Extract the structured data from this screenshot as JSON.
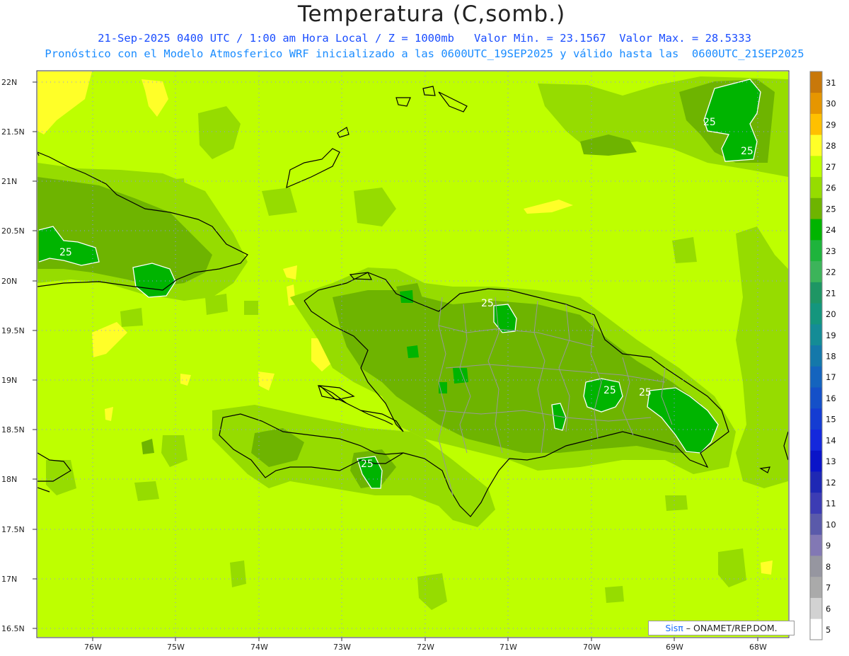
{
  "title": "Temperatura (C,somb.)",
  "subtitle_line1": "21-Sep-2025 0400 UTC / 1:00 am Hora Local / Z = 1000mb   Valor Min. = 23.1567  Valor Max. = 28.5333",
  "subtitle_line2": "Pronóstico con el Modelo Atmosferico WRF inicializado a las 0600UTC_19SEP2025 y válido hasta las  0600UTC_21SEP2025",
  "lat_labels": [
    "22N",
    "21.5N",
    "21N",
    "20.5N",
    "20N",
    "19.5N",
    "19N",
    "18.5N",
    "18N",
    "17.5N",
    "17N",
    "16.5N"
  ],
  "lon_labels": [
    "76W",
    "75W",
    "74W",
    "73W",
    "72W",
    "71W",
    "70W",
    "69W",
    "68W"
  ],
  "contour_labels": [
    "25",
    "25",
    "25",
    "25",
    "25",
    "25",
    "25"
  ],
  "colorbar": {
    "labels": [
      "31",
      "30",
      "29",
      "28",
      "27",
      "26",
      "25",
      "24",
      "23",
      "22",
      "21",
      "20",
      "19",
      "18",
      "17",
      "16",
      "15",
      "14",
      "13",
      "12",
      "11",
      "10",
      "9",
      "8",
      "7",
      "6",
      "5"
    ],
    "colors": [
      "#c8780a",
      "#e69600",
      "#ffc000",
      "#ffff28",
      "#beff00",
      "#96dc00",
      "#6eb400",
      "#00b400",
      "#1eb43c",
      "#3cb45a",
      "#1e9664",
      "#14967d",
      "#148c96",
      "#1478aa",
      "#1464be",
      "#1450c8",
      "#143cd2",
      "#1428dc",
      "#0a14c8",
      "#1e28b4",
      "#3c3cb4",
      "#5a5aaa",
      "#8278b4",
      "#9696a0",
      "#aaaaaa",
      "#d2d2d2",
      "#ffffff"
    ]
  },
  "credit": {
    "brand": "Sisπ",
    "text": "– ONAMET/REP.DOM."
  },
  "colors": {
    "base": "#beff00",
    "level26": "#96dc00",
    "level25": "#6eb400",
    "level24": "#00b400",
    "level28": "#ffff28",
    "coast": "#000000",
    "border": "#999999"
  }
}
